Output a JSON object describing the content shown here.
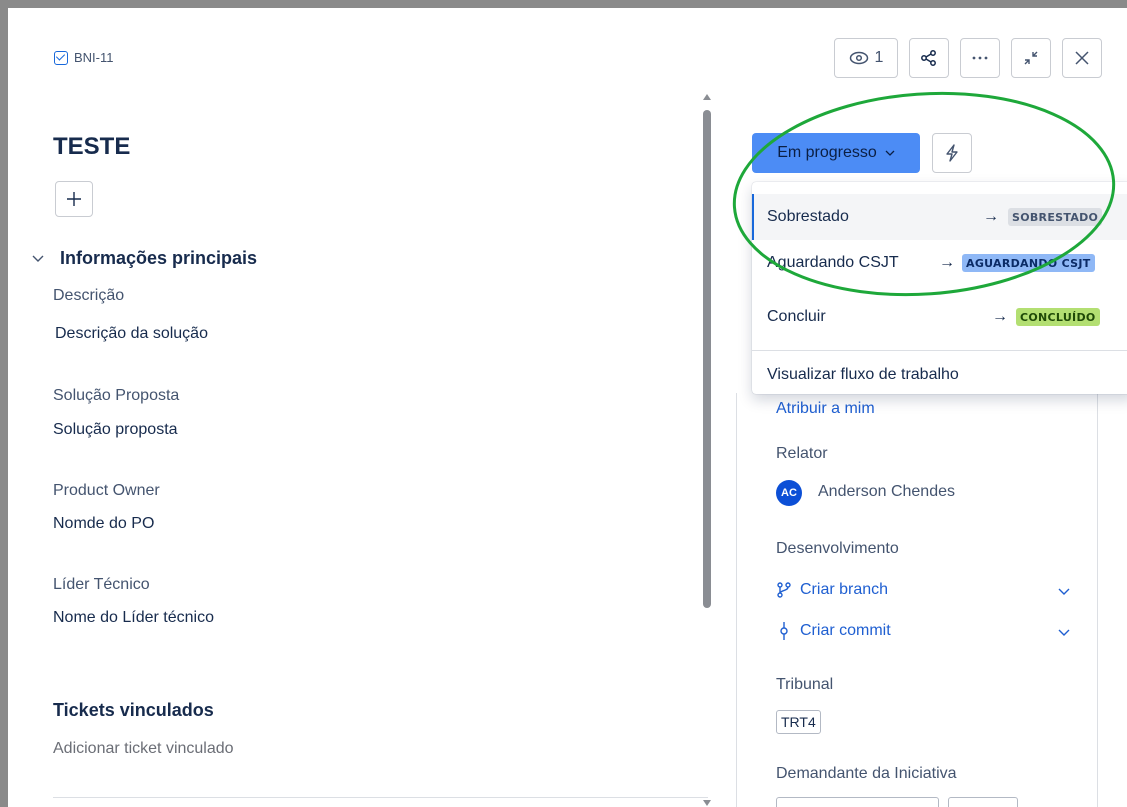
{
  "header": {
    "issue_key": "BNI-11",
    "watch_count": "1"
  },
  "issue": {
    "title": "TESTE"
  },
  "main_section": {
    "title": "Informações principais",
    "fields": [
      {
        "label": "Descrição",
        "value": "Descrição da solução"
      },
      {
        "label": "Solução Proposta",
        "value": "Solução proposta"
      },
      {
        "label": "Product Owner",
        "value": "Nomde do PO"
      },
      {
        "label": "Líder Técnico",
        "value": "Nome do Líder técnico"
      }
    ]
  },
  "linked_tickets": {
    "title": "Tickets vinculados",
    "add_label": "Adicionar ticket vinculado"
  },
  "status": {
    "current": "Em progresso"
  },
  "status_dropdown": {
    "transitions": [
      {
        "label": "Sobrestado",
        "arrow": "→",
        "target": "SOBRESTADO"
      },
      {
        "label": "Aguardando CSJT",
        "arrow": "→",
        "target": "AGUARDANDO CSJT"
      },
      {
        "label": "Concluir",
        "arrow": "→",
        "target": "CONCLUÍDO"
      }
    ],
    "footer": "Visualizar fluxo de trabalho"
  },
  "details": {
    "assign_to_me": "Atribuir a mim",
    "reporter_label": "Relator",
    "reporter_initials": "AC",
    "reporter_name": "Anderson Chendes",
    "development_label": "Desenvolvimento",
    "create_branch": "Criar branch",
    "create_commit": "Criar commit",
    "tribunal_label": "Tribunal",
    "tribunal_value": "TRT4",
    "demandante_label": "Demandante da Iniciativa"
  },
  "colors": {
    "status_button": "#4c8cf5",
    "link": "#1f5fd1",
    "annotation_ellipse": "#1ea83a",
    "lozenge_grey": "#dcdfe4",
    "lozenge_blue": "#8fb8f6",
    "lozenge_green": "#b3df72"
  }
}
